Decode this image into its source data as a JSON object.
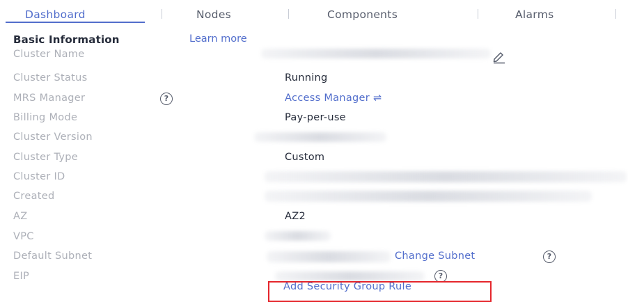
{
  "tabs": [
    {
      "label": "Dashboard"
    },
    {
      "label": "Nodes"
    },
    {
      "label": "Components"
    },
    {
      "label": "Alarms"
    }
  ],
  "basic_info": {
    "title": "Basic Information",
    "learn_more": "Learn more"
  },
  "rows": {
    "cluster_name": {
      "label": "Cluster Name"
    },
    "cluster_status": {
      "label": "Cluster Status",
      "value": "Running"
    },
    "mrs_manager": {
      "label": "MRS Manager",
      "link": "Access Manager ⇌"
    },
    "billing_mode": {
      "label": "Billing Mode",
      "value": "Pay-per-use"
    },
    "cluster_version": {
      "label": "Cluster Version"
    },
    "cluster_type": {
      "label": "Cluster Type",
      "value": "Custom"
    },
    "cluster_id": {
      "label": "Cluster ID"
    },
    "created": {
      "label": "Created"
    },
    "az": {
      "label": "AZ",
      "value": "AZ2"
    },
    "vpc": {
      "label": "VPC"
    },
    "default_subnet": {
      "label": "Default Subnet",
      "link": "Change Subnet"
    },
    "eip": {
      "label": "EIP",
      "link": "Add Security Group Rule"
    }
  },
  "icons": {
    "help": "?",
    "edit": "pencil-icon"
  },
  "colors": {
    "accent": "#526ecc",
    "label": "#adb0b8",
    "text": "#252b3a",
    "highlight": "#e5262c"
  }
}
